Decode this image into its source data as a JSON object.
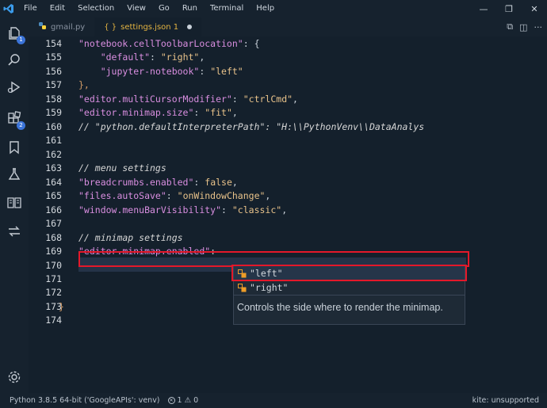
{
  "menu": [
    "File",
    "Edit",
    "Selection",
    "View",
    "Go",
    "Run",
    "Terminal",
    "Help"
  ],
  "tabs": [
    {
      "label": "gmail.py",
      "icon": "python-file-icon"
    },
    {
      "label": "settings.json 1",
      "icon": "json-braces-icon",
      "glyph": "{ }",
      "modified": true
    }
  ],
  "line_numbers": [
    "154",
    "155",
    "156",
    "157",
    "158",
    "159",
    "160",
    "161",
    "162",
    "163",
    "164",
    "165",
    "166",
    "167",
    "168",
    "169",
    "170",
    "171",
    "172",
    "173",
    "174"
  ],
  "code": {
    "l154": {
      "key": "\"notebook.cellToolbarLocation\"",
      "punct": ": {"
    },
    "l155": {
      "key": "\"default\"",
      "sep": ": ",
      "val": "\"right\"",
      "end": ","
    },
    "l156": {
      "key": "\"jupyter-notebook\"",
      "sep": ": ",
      "val": "\"left\""
    },
    "l157": {
      "text": "},"
    },
    "l158": {
      "key": "\"editor.multiCursorModifier\"",
      "sep": ": ",
      "val": "\"ctrlCmd\"",
      "end": ","
    },
    "l159": {
      "key": "\"editor.minimap.size\"",
      "sep": ": ",
      "val": "\"fit\"",
      "end": ","
    },
    "l160": {
      "comment": "// \"python.defaultInterpreterPath\": \"H:\\\\PythonVenv\\\\DataAnalys"
    },
    "l163": {
      "comment": "// menu settings"
    },
    "l164": {
      "key": "\"breadcrumbs.enabled\"",
      "sep": ": ",
      "val": "false",
      "end": ","
    },
    "l165": {
      "key": "\"files.autoSave\"",
      "sep": ": ",
      "val": "\"onWindowChange\"",
      "end": ","
    },
    "l166": {
      "key": "\"window.menuBarVisibility\"",
      "sep": ": ",
      "val": "\"classic\"",
      "end": ","
    },
    "l168": {
      "comment": "// minimap settings"
    },
    "l169": {
      "key": "\"editor.minimap.enabled\"",
      "sep": ":"
    },
    "l173": {
      "text": "}"
    }
  },
  "suggest": {
    "items": [
      "\"left\"",
      "\"right\""
    ],
    "doc": "Controls the side where to render the minimap."
  },
  "status": {
    "python": "Python 3.8.5 64-bit ('GoogleAPIs': venv)",
    "errors": "1",
    "warnings": "0",
    "kite": "kite: unsupported"
  },
  "colors": {
    "highlight_box": "#e4182a",
    "accent": "#3b74d9"
  }
}
